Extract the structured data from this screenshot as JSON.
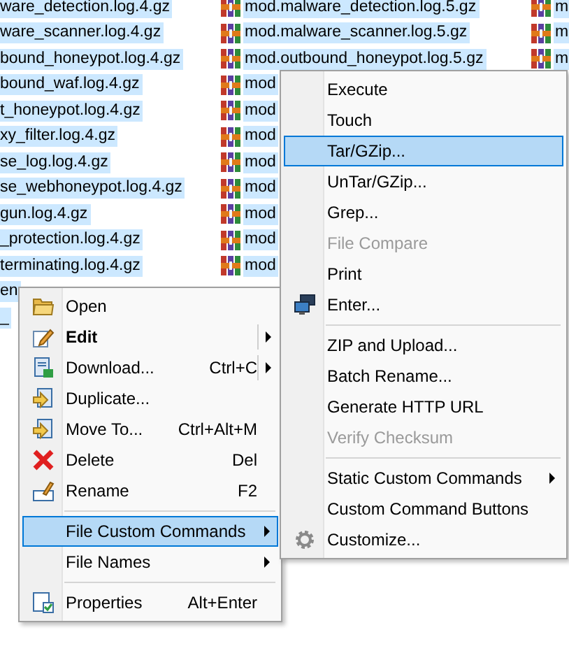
{
  "file_list": {
    "columns": [
      {
        "rows": [
          {
            "name": "ware_detection.log.4.gz",
            "selected": true
          },
          {
            "name": "ware_scanner.log.4.gz",
            "selected": true
          },
          {
            "name": "bound_honeypot.log.4.gz",
            "selected": true
          },
          {
            "name": "bound_waf.log.4.gz",
            "selected": true
          },
          {
            "name": "t_honeypot.log.4.gz",
            "selected": true
          },
          {
            "name": "xy_filter.log.4.gz",
            "selected": true
          },
          {
            "name": "se_log.log.4.gz",
            "selected": true
          },
          {
            "name": "se_webhoneypot.log.4.gz",
            "selected": true
          },
          {
            "name": "gun.log.4.gz",
            "selected": true
          },
          {
            "name": "_protection.log.4.gz",
            "selected": true
          },
          {
            "name": "terminating.log.4.gz",
            "selected": true
          },
          {
            "name": "en",
            "selected": true
          },
          {
            "name": "_",
            "selected": true
          }
        ]
      },
      {
        "rows": [
          {
            "name": "mod.malware_detection.log.5.gz",
            "selected": true
          },
          {
            "name": "mod.malware_scanner.log.5.gz",
            "selected": true
          },
          {
            "name": "mod.outbound_honeypot.log.5.gz",
            "selected": true
          },
          {
            "name": "mod",
            "selected": true
          },
          {
            "name": "mod",
            "selected": true
          },
          {
            "name": "mod",
            "selected": true
          },
          {
            "name": "mod",
            "selected": true
          },
          {
            "name": "mod",
            "selected": true
          },
          {
            "name": "mod",
            "selected": true
          },
          {
            "name": "mod",
            "selected": true
          },
          {
            "name": "mod",
            "selected": true
          }
        ]
      },
      {
        "rows": [
          {
            "name": "m",
            "selected": true
          },
          {
            "name": "m",
            "selected": true
          },
          {
            "name": "m",
            "selected": true
          }
        ]
      }
    ]
  },
  "context_menu": {
    "items": [
      {
        "kind": "item",
        "label": "Open",
        "selected": false,
        "bold": false
      },
      {
        "kind": "item",
        "label": "Edit",
        "selected": false,
        "bold": true,
        "submenu": true,
        "split": true
      },
      {
        "kind": "item",
        "label": "Download...",
        "shortcut": "Ctrl+C",
        "selected": false,
        "bold": false,
        "submenu": true,
        "split": true
      },
      {
        "kind": "item",
        "label": "Duplicate...",
        "selected": false,
        "bold": false
      },
      {
        "kind": "item",
        "label": "Move To...",
        "shortcut": "Ctrl+Alt+M",
        "selected": false,
        "bold": false
      },
      {
        "kind": "item",
        "label": "Delete",
        "shortcut": "Del",
        "selected": false,
        "bold": false
      },
      {
        "kind": "item",
        "label": "Rename",
        "shortcut": "F2",
        "selected": false,
        "bold": false
      },
      {
        "kind": "separator"
      },
      {
        "kind": "item",
        "label": "File Custom Commands",
        "selected": true,
        "bold": false,
        "submenu": true
      },
      {
        "kind": "item",
        "label": "File Names",
        "selected": false,
        "bold": false,
        "submenu": true
      },
      {
        "kind": "separator"
      },
      {
        "kind": "item",
        "label": "Properties",
        "shortcut": "Alt+Enter",
        "selected": false,
        "bold": false
      }
    ]
  },
  "submenu": {
    "items": [
      {
        "kind": "item",
        "label": "Execute",
        "selected": false,
        "disabled": false
      },
      {
        "kind": "item",
        "label": "Touch",
        "selected": false,
        "disabled": false
      },
      {
        "kind": "item",
        "label": "Tar/GZip...",
        "selected": true,
        "disabled": false
      },
      {
        "kind": "item",
        "label": "UnTar/GZip...",
        "selected": false,
        "disabled": false
      },
      {
        "kind": "item",
        "label": "Grep...",
        "selected": false,
        "disabled": false
      },
      {
        "kind": "item",
        "label": "File Compare",
        "selected": false,
        "disabled": true
      },
      {
        "kind": "item",
        "label": "Print",
        "selected": false,
        "disabled": false
      },
      {
        "kind": "item",
        "label": "Enter...",
        "selected": false,
        "disabled": false
      },
      {
        "kind": "separator"
      },
      {
        "kind": "item",
        "label": "ZIP and Upload...",
        "selected": false,
        "disabled": false
      },
      {
        "kind": "item",
        "label": "Batch Rename...",
        "selected": false,
        "disabled": false
      },
      {
        "kind": "item",
        "label": "Generate HTTP URL",
        "selected": false,
        "disabled": false
      },
      {
        "kind": "item",
        "label": "Verify Checksum",
        "selected": false,
        "disabled": true
      },
      {
        "kind": "separator"
      },
      {
        "kind": "item",
        "label": "Static Custom Commands",
        "selected": false,
        "disabled": false,
        "submenu": true
      },
      {
        "kind": "item",
        "label": "Custom Command Buttons",
        "selected": false,
        "disabled": false
      },
      {
        "kind": "item",
        "label": "Customize...",
        "selected": false,
        "disabled": false
      }
    ]
  }
}
